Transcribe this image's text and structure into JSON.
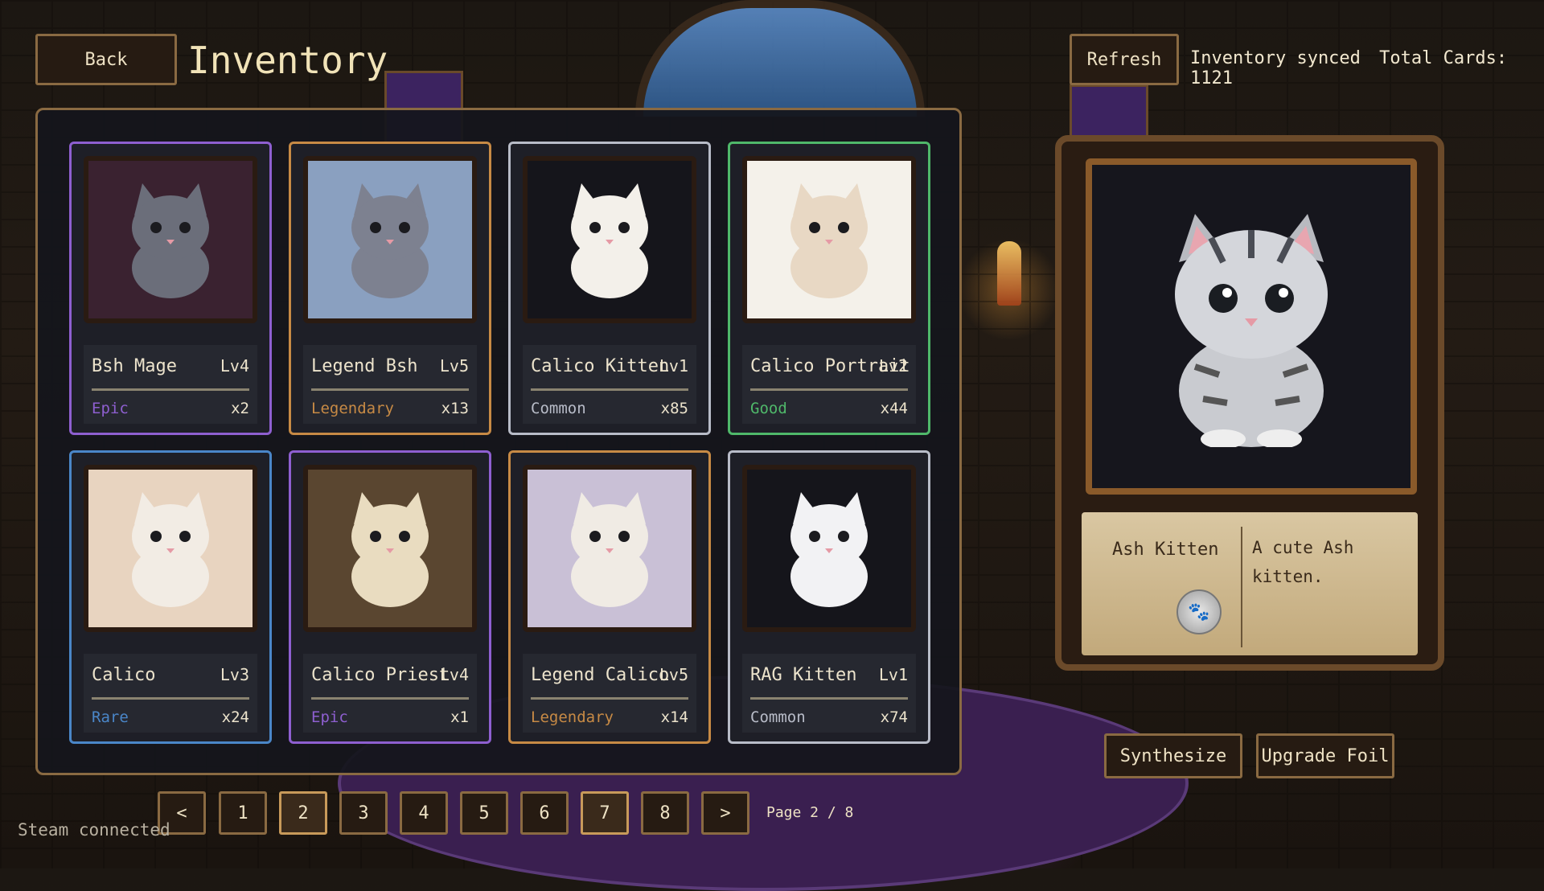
{
  "header": {
    "back_label": "Back",
    "title": "Inventory",
    "refresh_label": "Refresh",
    "status_text": "Inventory synced",
    "total_cards_text": "Total Cards: 1121"
  },
  "cards": [
    {
      "name": "Bsh Mage",
      "level": "Lv4",
      "rarity": "Epic",
      "qty": "x2",
      "color": "#8e5fd0",
      "art": "grey-wizard-cat"
    },
    {
      "name": "Legend Bsh",
      "level": "Lv5",
      "rarity": "Legendary",
      "qty": "x13",
      "color": "#c78a45",
      "art": "grey-cat-throne-room"
    },
    {
      "name": "Calico Kitten",
      "level": "Lv1",
      "rarity": "Common",
      "qty": "x85",
      "color": "#b8bcc8",
      "art": "calico-kitten"
    },
    {
      "name": "Calico Portrait",
      "level": "Lv2",
      "rarity": "Good",
      "qty": "x44",
      "color": "#4fb86a",
      "art": "calico-portrait"
    },
    {
      "name": "Calico",
      "level": "Lv3",
      "rarity": "Rare",
      "qty": "x24",
      "color": "#4a86c8",
      "art": "calico-cat-room"
    },
    {
      "name": "Calico Priest",
      "level": "Lv4",
      "rarity": "Epic",
      "qty": "x1",
      "color": "#8e5fd0",
      "art": "calico-priest-cat"
    },
    {
      "name": "Legend Calico",
      "level": "Lv5",
      "rarity": "Legendary",
      "qty": "x14",
      "color": "#c78a45",
      "art": "calico-castle-hall"
    },
    {
      "name": "RAG Kitten",
      "level": "Lv1",
      "rarity": "Common",
      "qty": "x74",
      "color": "#b8bcc8",
      "art": "white-ragdoll-kitten"
    }
  ],
  "pagination": {
    "prev": "<",
    "next": ">",
    "pages": [
      "1",
      "2",
      "3",
      "4",
      "5",
      "6",
      "7",
      "8"
    ],
    "current_page": "2",
    "label": "Page 2 / 8"
  },
  "footer": {
    "steam_status": "Steam connected"
  },
  "detail": {
    "name": "Ash Kitten",
    "description": "A cute Ash kitten.",
    "seal_icon": "paw-icon",
    "art": "grey-tabby-kitten"
  },
  "actions": {
    "synthesize_label": "Synthesize",
    "upgrade_label": "Upgrade Foil"
  }
}
